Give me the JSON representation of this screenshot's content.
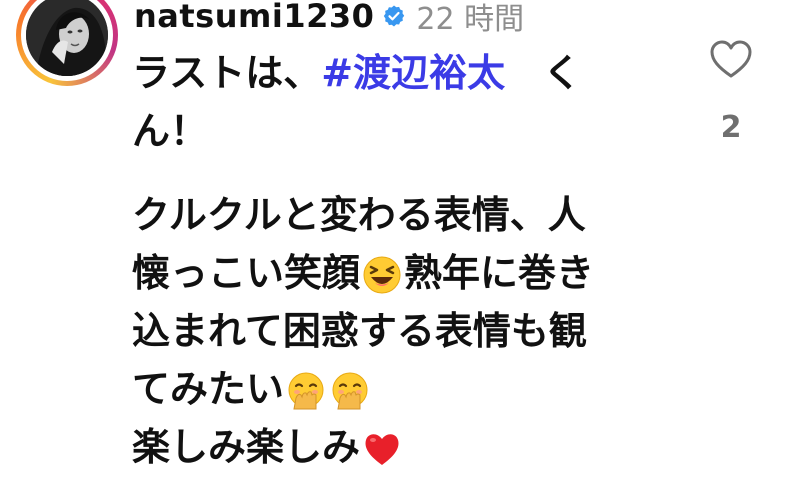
{
  "post": {
    "username": "natsumi1230",
    "verified": true,
    "timestamp": "22 時間",
    "avatar_icon": "profile-photo",
    "verified_icon": "verified-badge-icon",
    "verified_color": "#3897f0",
    "hashtag_color": "#3b3be6",
    "comment": {
      "line1_text": "ラストは、",
      "line1_hashtag": "#渡辺裕太",
      "line1_tail": "　く",
      "line2": "ん！",
      "line3": "クルクルと変わる表情、人",
      "line4_text": "懐っこい笑顔",
      "line4_emoji": "laughing-face-emoji",
      "line4_tail": "熟年に巻き",
      "line5": "込まれて困惑する表情も観",
      "line6_text": "てみたい",
      "line6_emoji_1": "face-with-hand-over-mouth-emoji",
      "line6_emoji_2": "face-with-hand-over-mouth-emoji",
      "line7_text": "楽しみ楽しみ",
      "line7_emoji": "red-heart-emoji"
    },
    "like": {
      "icon": "heart-outline-icon",
      "count": "2"
    }
  }
}
